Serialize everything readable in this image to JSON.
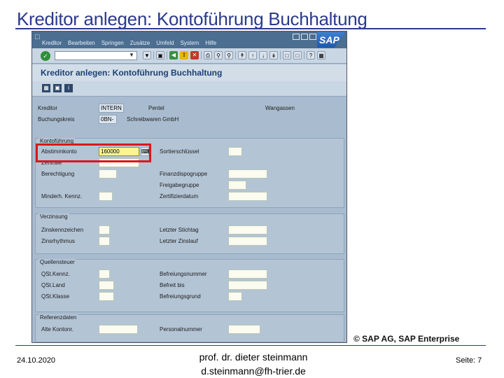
{
  "slide": {
    "title": "Kreditor anlegen: Kontoführung Buchhaltung",
    "copyright": "© SAP AG, SAP Enterprise",
    "date": "24.10.2020",
    "author": "prof. dr. dieter steinmann",
    "email": "d.steinmann@fh-trier.de",
    "page": "Seite: 7"
  },
  "sap": {
    "menu": [
      "Kreditor",
      "Bearbeiten",
      "Springen",
      "Zusätze",
      "Umfeld",
      "System",
      "Hilfe"
    ],
    "logo": "SAP",
    "screen_title": "Kreditor anlegen: Kontoführung Buchhaltung",
    "header": {
      "kreditor_label": "Kreditor",
      "kreditor_value": "INTERN",
      "kreditor_name": "Pentel",
      "kreditor_city": "Wangassen",
      "bukrs_label": "Buchungskreis",
      "bukrs_value": "0BN-",
      "bukrs_name": "Schreibwaren GmbH"
    },
    "groups": {
      "kontofuehrung": {
        "title": "Kontoführung",
        "abstimmkonto_label": "Abstimmkonto",
        "abstimmkonto_value": "160000",
        "zentrale_label": "Zentrale",
        "berechtigung_label": "Berechtigung",
        "mindergr_label": "Minderh. Kennz.",
        "sortierschluessel_label": "Sortierschlüssel",
        "finanzdispo_label": "Finanzdispogruppe",
        "freigabegruppe_label": "Freigabegruppe",
        "zertifizierung_label": "Zertifizierdatum"
      },
      "verzinsung": {
        "title": "Verzinsung",
        "zinskennzeichen_label": "Zinskennzeichen",
        "zinsrhythmus_label": "Zinsrhythmus",
        "letzter_stichtag_label": "Letzter Stichtag",
        "letzter_zinslauf_label": "Letzter Zinslauf"
      },
      "quellensteuer": {
        "title": "Quellensteuer",
        "qstkennz_label": "QSt.Kennz.",
        "qstland_label": "QSt.Land",
        "qstklasse_label": "QSt.Klasse",
        "befreiungsnummer_label": "Befreiungsnummer",
        "gueltig_bis_label": "Befreit bis",
        "befreiungsgrund_label": "Befreiungsgrund"
      },
      "referenzdaten": {
        "title": "Referenzdaten",
        "alte_kontonr_label": "Alte Kontonr.",
        "personalnummer_label": "Personalnummer"
      }
    }
  }
}
